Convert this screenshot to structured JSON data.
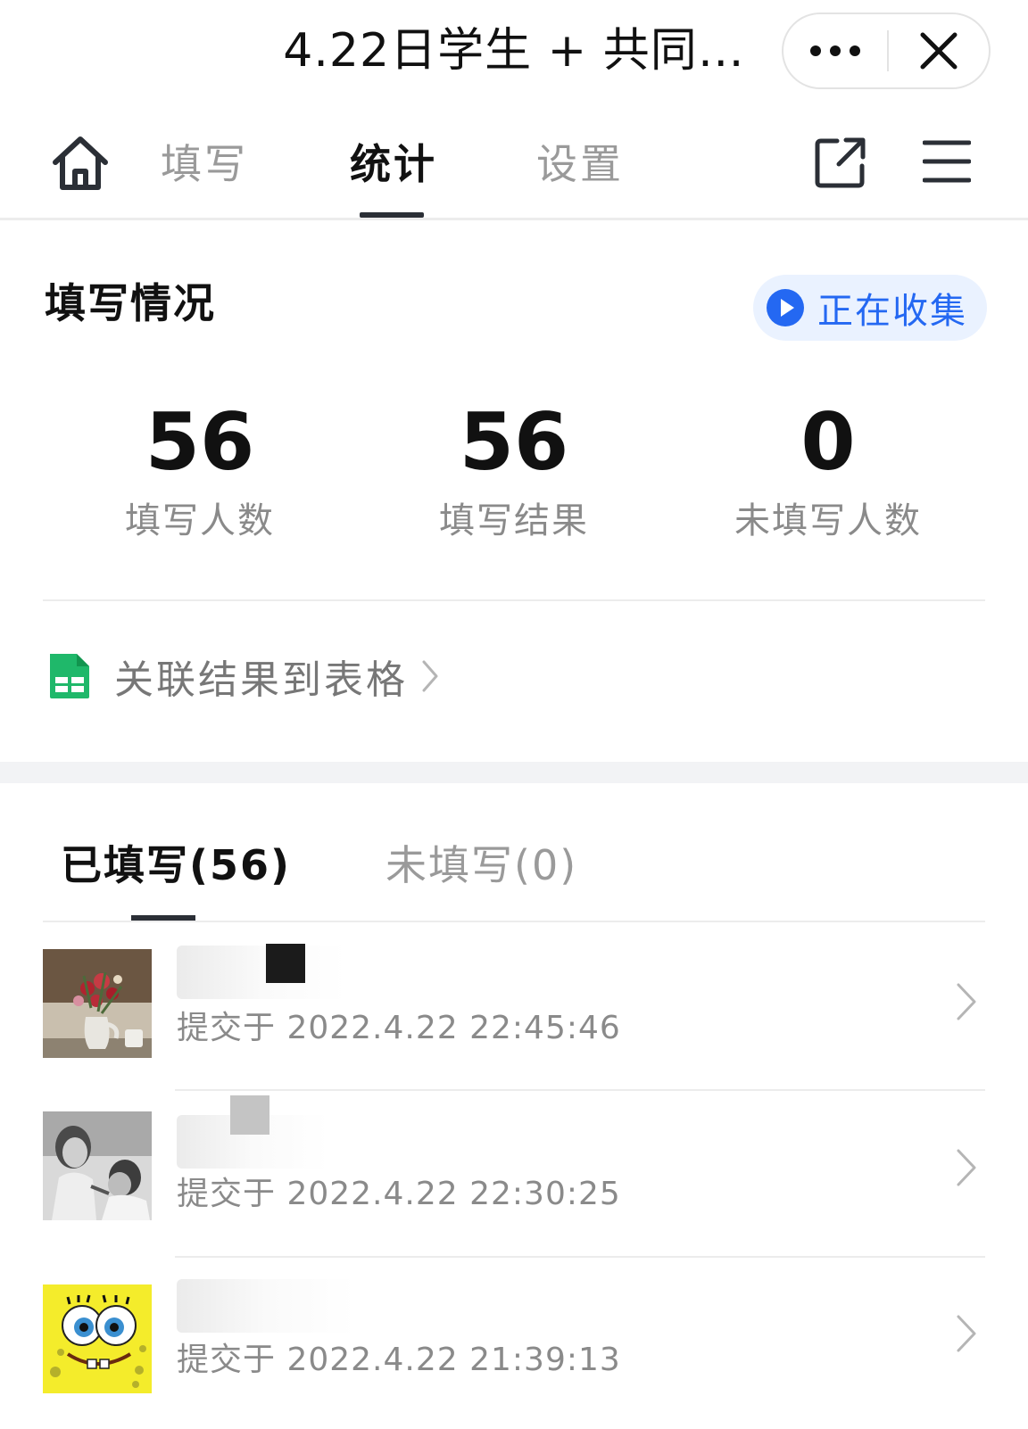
{
  "header": {
    "title": "4.22日学生 + 共同…"
  },
  "nav": {
    "tabs": [
      {
        "label": "填写",
        "active": false
      },
      {
        "label": "统计",
        "active": true
      },
      {
        "label": "设置",
        "active": false
      }
    ],
    "icons": [
      "home-icon",
      "share-icon",
      "menu-icon"
    ]
  },
  "summary": {
    "title": "填写情况",
    "status": "正在收集",
    "status_color": "#2468f2",
    "stats": [
      {
        "value": "56",
        "label": "填写人数"
      },
      {
        "value": "56",
        "label": "填写结果"
      },
      {
        "value": "0",
        "label": "未填写人数"
      }
    ],
    "sheet_link": "关联结果到表格"
  },
  "sub_tabs": [
    {
      "label": "已填写(56)",
      "active": true
    },
    {
      "label": "未填写(0)",
      "active": false
    }
  ],
  "submissions": [
    {
      "time": "提交于 2022.4.22 22:45:46",
      "avatar": "flowers-vase-photo"
    },
    {
      "time": "提交于 2022.4.22 22:30:25",
      "avatar": "vintage-bw-photo"
    },
    {
      "time": "提交于 2022.4.22 21:39:13",
      "avatar": "spongebob-avatar"
    }
  ]
}
